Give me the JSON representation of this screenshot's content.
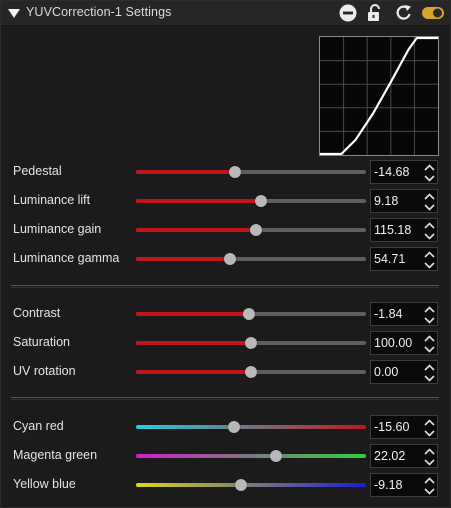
{
  "window": {
    "title": "YUVCorrection-1 Settings"
  },
  "titlebar_icons": [
    "collapse-arrow-icon",
    "minus-circle-icon",
    "unlock-icon",
    "reset-icon",
    "toggle-icon"
  ],
  "colors": {
    "red_fill": "#c4141b",
    "track": "#5f5f5f",
    "toggle": "#d7a52a",
    "cyan": "#20d0e0",
    "magenta": "#d020c8",
    "green": "#2bd13a",
    "yellow": "#d8d81a",
    "blue": "#1c1cd6"
  },
  "curve": {
    "points": [
      [
        0,
        0
      ],
      [
        0.18,
        0
      ],
      [
        0.3,
        0.12
      ],
      [
        0.45,
        0.35
      ],
      [
        0.6,
        0.62
      ],
      [
        0.75,
        0.9
      ],
      [
        0.82,
        1
      ],
      [
        1,
        1
      ]
    ]
  },
  "group1": [
    {
      "label": "Pedestal",
      "value": "-14.68",
      "fraction": 0.43
    },
    {
      "label": "Luminance lift",
      "value": "9.18",
      "fraction": 0.545
    },
    {
      "label": "Luminance gain",
      "value": "115.18",
      "fraction": 0.52
    },
    {
      "label": "Luminance gamma",
      "value": "54.71",
      "fraction": 0.41
    }
  ],
  "group2": [
    {
      "label": "Contrast",
      "value": "-1.84",
      "fraction": 0.49
    },
    {
      "label": "Saturation",
      "value": "100.00",
      "fraction": 0.5
    },
    {
      "label": "UV rotation",
      "value": "0.00",
      "fraction": 0.5
    }
  ],
  "group3": [
    {
      "label": "Cyan red",
      "value": "-15.60",
      "fraction": 0.425
    },
    {
      "label": "Magenta green",
      "value": "22.02",
      "fraction": 0.61
    },
    {
      "label": "Yellow blue",
      "value": "-9.18",
      "fraction": 0.455
    }
  ]
}
